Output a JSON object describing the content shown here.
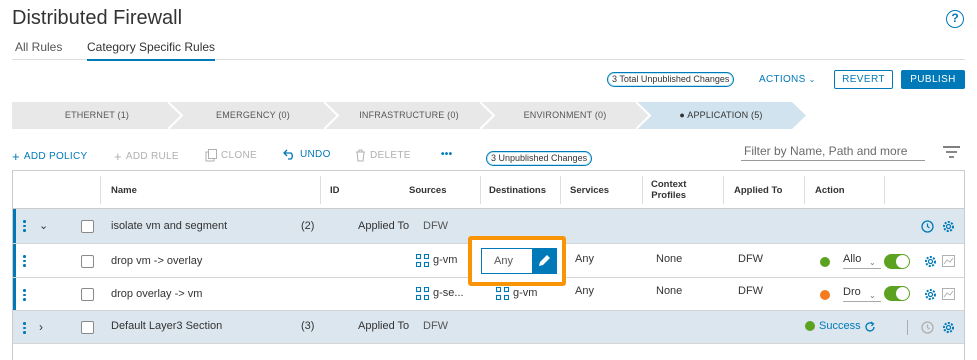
{
  "page": {
    "title": "Distributed Firewall",
    "help_label": "?"
  },
  "tabs": [
    {
      "label": "All Rules",
      "active": false
    },
    {
      "label": "Category Specific Rules",
      "active": true
    }
  ],
  "top_actions": {
    "total_unpublished": "3 Total Unpublished Changes",
    "actions_label": "ACTIONS",
    "revert_label": "REVERT",
    "publish_label": "PUBLISH"
  },
  "categories": [
    {
      "label": "ETHERNET (1)"
    },
    {
      "label": "EMERGENCY (0)"
    },
    {
      "label": "INFRASTRUCTURE (0)"
    },
    {
      "label": "ENVIRONMENT (0)"
    },
    {
      "label": "● APPLICATION (5)",
      "active": true
    }
  ],
  "toolbar": {
    "add_policy": "ADD POLICY",
    "add_rule": "ADD RULE",
    "clone": "CLONE",
    "undo": "UNDO",
    "delete": "DELETE",
    "more": "•••",
    "unpublished": "3 Unpublished Changes",
    "filter_placeholder": "Filter by Name, Path and more"
  },
  "columns": {
    "name": "Name",
    "id": "ID",
    "sources": "Sources",
    "destinations": "Destinations",
    "services": "Services",
    "context_profiles_1": "Context",
    "context_profiles_2": "Profiles",
    "applied_to": "Applied To",
    "action": "Action"
  },
  "policies": [
    {
      "name": "isolate vm and segment",
      "count": "(2)",
      "applied_to_label": "Applied To",
      "applied_to": "DFW",
      "rules": [
        {
          "name": "drop vm -> overlay",
          "source": "g-vm",
          "destination": "Any",
          "service": "Any",
          "profile": "None",
          "applied_to": "DFW",
          "action": "Allow",
          "action_display": "Allo",
          "action_color": "#5aa220"
        },
        {
          "name": "drop overlay -> vm",
          "source": "g-se...",
          "destination": "g-vm",
          "service": "Any",
          "profile": "None",
          "applied_to": "DFW",
          "action": "Drop",
          "action_display": "Dro",
          "action_color": "#f57c1e"
        }
      ]
    },
    {
      "name": "Default Layer3 Section",
      "count": "(3)",
      "applied_to_label": "Applied To",
      "applied_to": "DFW",
      "status": "Success"
    }
  ],
  "colors": {
    "accent": "#0079b8",
    "highlight": "#f89406",
    "section_bg": "#dbe6ee",
    "success": "#5aa220"
  }
}
